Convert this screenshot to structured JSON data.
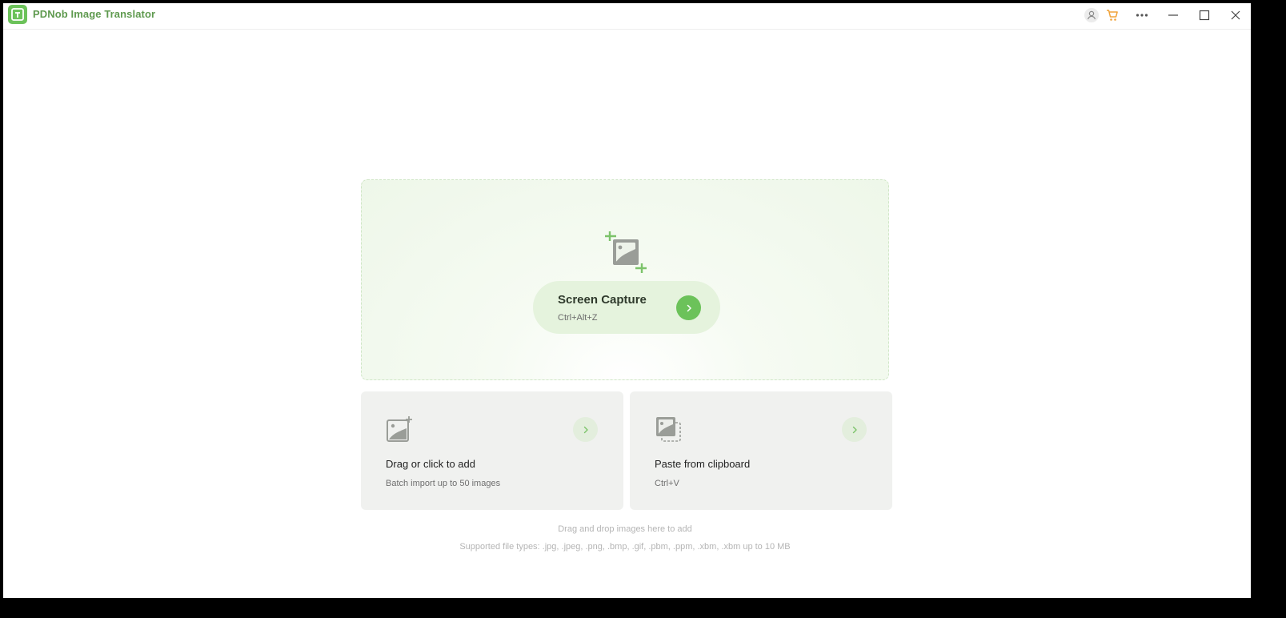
{
  "window": {
    "title": "PDNob Image Translator"
  },
  "titlebar": {
    "icons": [
      "user-icon",
      "cart-icon",
      "more-icon",
      "minimize-icon",
      "maximize-icon",
      "close-icon"
    ]
  },
  "colors": {
    "brand_green": "#6cc25a",
    "title_green": "#5f9a4f",
    "cart_orange": "#f0a33b"
  },
  "capture": {
    "title": "Screen Capture",
    "shortcut": "Ctrl+Alt+Z",
    "icon": "crop-image-icon"
  },
  "cards": [
    {
      "title": "Drag or click to add",
      "subtitle": "Batch import up to 50 images",
      "icon": "add-image-icon"
    },
    {
      "title": "Paste from clipboard",
      "subtitle": "Ctrl+V",
      "icon": "clipboard-image-icon"
    }
  ],
  "hints": {
    "drag_drop": "Drag and drop images here to add",
    "supported_types": "Supported file types: .jpg, .jpeg, .png, .bmp, .gif, .pbm, .ppm, .xbm, .xbm up to 10 MB"
  }
}
